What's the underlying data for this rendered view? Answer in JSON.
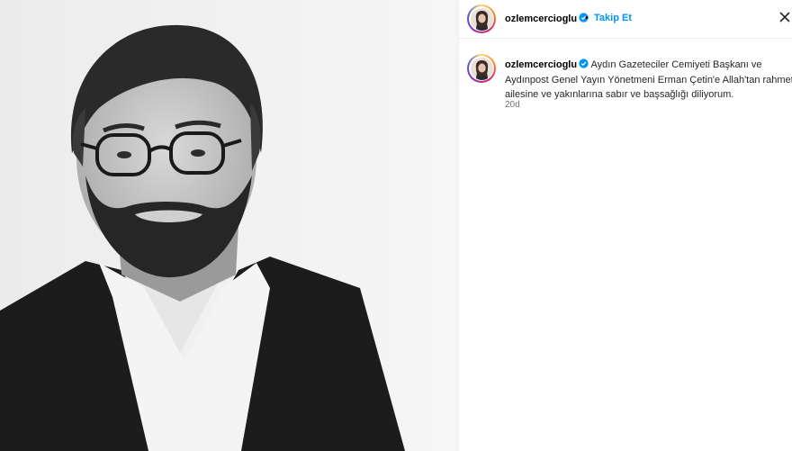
{
  "post": {
    "author": {
      "username": "ozlemcercioglu",
      "verified": true,
      "verified_icon": "verified-badge-icon"
    },
    "header": {
      "separator": "•",
      "follow_label": "Takip Et"
    },
    "caption": {
      "text": "Aydın Gazeteciler Cemiyeti Başkanı ve Aydınpost Genel Yayın Yönetmeni Erman Çetin'e Allah'tan rahmet, ailesine ve yakınlarına sabır ve başsağlığı diliyorum."
    },
    "timestamp": "20d",
    "image": {
      "subject": "black-and-white portrait of a bearded man with glasses"
    }
  },
  "colors": {
    "follow": "#0095f6",
    "verified": "#0095f6",
    "timestamp": "#737373"
  }
}
